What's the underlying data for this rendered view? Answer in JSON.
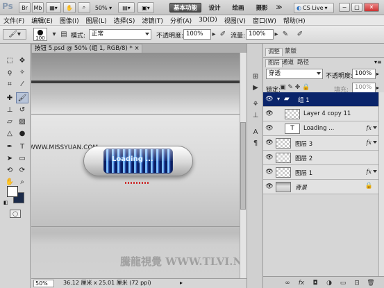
{
  "app": {
    "logo": "Ps",
    "zoom": "50%",
    "workspaces": [
      "基本功能",
      "设计",
      "绘画",
      "摄影"
    ],
    "more": "≫",
    "cs_live": "CS Live"
  },
  "menu": [
    "文件(F)",
    "编辑(E)",
    "图像(I)",
    "图层(L)",
    "选择(S)",
    "滤镜(T)",
    "分析(A)",
    "3D(D)",
    "视图(V)",
    "窗口(W)",
    "帮助(H)"
  ],
  "options": {
    "brush_size": "100",
    "mode_label": "模式:",
    "mode_value": "正常",
    "opacity_label": "不透明度:",
    "opacity_value": "100%",
    "flow_label": "流量:",
    "flow_value": "100%"
  },
  "document": {
    "tab_title": "按钮 5.psd @ 50% (组 1, RGB/8) *",
    "tab_close": "×",
    "loading_text": "Loading ...",
    "watermark_top": "思缘设计论坛 WWW.MISSYUAN.COM",
    "watermark_bottom": "騰龍視覺 WWW.TLVI.NET",
    "status_zoom": "50%",
    "status_info": "36.12 厘米 x 25.01 厘米 (72 ppi)"
  },
  "panels": {
    "top_tabs": [
      "调整",
      "蒙版"
    ],
    "layer_tabs": [
      "图层",
      "通道",
      "路径"
    ],
    "blend_mode": "穿透",
    "opacity_label": "不透明度:",
    "opacity_value": "100%",
    "lock_label": "锁定:",
    "fill_label": "填充:",
    "fill_value": "100%",
    "layers": [
      {
        "name": "组 1",
        "type": "group",
        "selected": true,
        "fx": ""
      },
      {
        "name": "Layer 4 copy 11",
        "type": "pixel",
        "selected": false,
        "fx": ""
      },
      {
        "name": "Loading ...",
        "type": "text",
        "selected": false,
        "fx": "fx"
      },
      {
        "name": "图层 3",
        "type": "pixel",
        "selected": false,
        "fx": "fx"
      },
      {
        "name": "图层 2",
        "type": "pixel",
        "selected": false,
        "fx": ""
      },
      {
        "name": "图层 1",
        "type": "pixel",
        "selected": false,
        "fx": "fx"
      },
      {
        "name": "背景",
        "type": "background",
        "selected": false,
        "fx": ""
      }
    ],
    "text_thumb_glyph": "T"
  },
  "colors": {
    "selected_layer": "#0a246a",
    "foreground": "#ffffff",
    "background": "#1c2b4a"
  }
}
